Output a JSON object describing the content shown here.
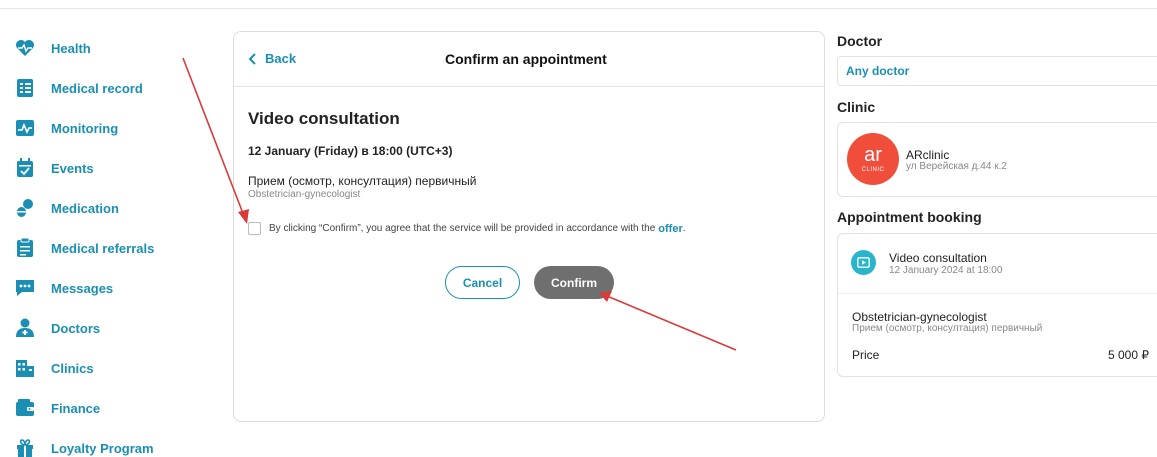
{
  "colors": {
    "accent": "#1a8fb3",
    "confirm_bg": "#6f6f6f",
    "arrow": "#d93b3b",
    "logo": "#f04e3b",
    "video_icon": "#29b6cc"
  },
  "sidebar": {
    "items": [
      {
        "label": "Health",
        "icon": "heart-icon"
      },
      {
        "label": "Medical record",
        "icon": "notebook-icon"
      },
      {
        "label": "Monitoring",
        "icon": "chart-icon"
      },
      {
        "label": "Events",
        "icon": "calendar-icon"
      },
      {
        "label": "Medication",
        "icon": "pills-icon"
      },
      {
        "label": "Medical referrals",
        "icon": "clipboard-icon"
      },
      {
        "label": "Messages",
        "icon": "chat-icon"
      },
      {
        "label": "Doctors",
        "icon": "doctor-icon"
      },
      {
        "label": "Clinics",
        "icon": "building-icon"
      },
      {
        "label": "Finance",
        "icon": "wallet-icon"
      },
      {
        "label": "Loyalty Program",
        "icon": "gift-icon"
      }
    ]
  },
  "card": {
    "back_label": "Back",
    "title": "Confirm an appointment",
    "consultation_title": "Video consultation",
    "date_line": "12 January (Friday) в 18:00 (UTC+3)",
    "service_name": "Прием (осмотр, консултация) первичный",
    "specialty": "Obstetrician-gynecologist",
    "agreement_text": "By clicking “Confirm”, you agree that the service will be provided in accordance with the",
    "offer_link": "offer",
    "agreement_end": ".",
    "cancel_label": "Cancel",
    "confirm_label": "Confirm"
  },
  "right_panel": {
    "doctor_title": "Doctor",
    "doctor_value": "Any doctor",
    "clinic_title": "Clinic",
    "clinic_name": "ARclinic",
    "clinic_address": "ул Верейская д.44 к.2",
    "logo_text": "ar",
    "logo_subtext": "CLINIC",
    "booking_title": "Appointment booking",
    "booking_type": "Video consultation",
    "booking_date": "12 January 2024 at 18:00",
    "booking_specialty": "Obstetrician-gynecologist",
    "booking_service": "Прием (осмотр, консултация) первичный",
    "price_label": "Price",
    "price_value": "5 000 ₽"
  }
}
